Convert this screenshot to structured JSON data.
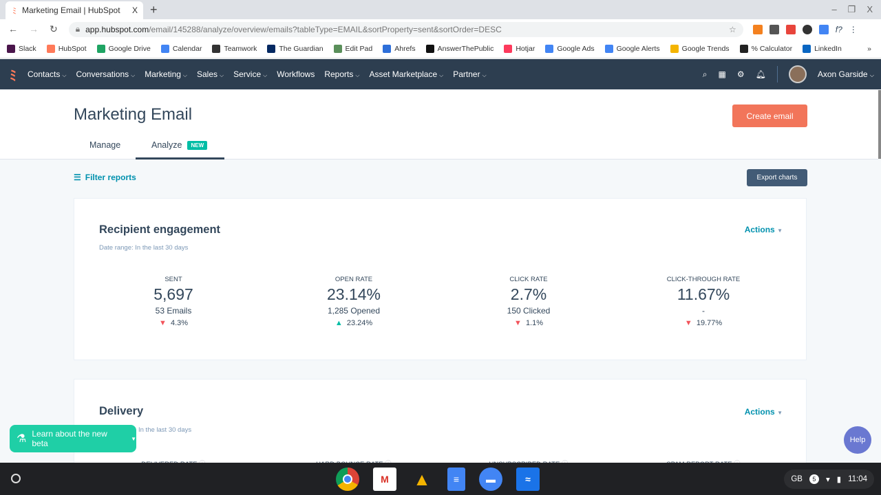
{
  "browser": {
    "tab_title": "Marketing Email | HubSpot",
    "tab_close": "X",
    "new_tab": "+",
    "window_controls": [
      "–",
      "❐",
      "X"
    ],
    "url_host": "app.hubspot.com",
    "url_path": "/email/145288/analyze/overview/emails?tableType=EMAIL&sortProperty=sent&sortOrder=DESC",
    "bookmarks": [
      {
        "label": "Slack",
        "color": "#4a154b"
      },
      {
        "label": "HubSpot",
        "color": "#ff7a59"
      },
      {
        "label": "Google Drive",
        "color": "#1fa463"
      },
      {
        "label": "Calendar",
        "color": "#4285f4"
      },
      {
        "label": "Teamwork",
        "color": "#333333"
      },
      {
        "label": "The Guardian",
        "color": "#052962"
      },
      {
        "label": "Edit Pad",
        "color": "#5a8f5a"
      },
      {
        "label": "Ahrefs",
        "color": "#2e6fd9"
      },
      {
        "label": "AnswerThePublic",
        "color": "#111111"
      },
      {
        "label": "Hotjar",
        "color": "#fd3a5c"
      },
      {
        "label": "Google Ads",
        "color": "#4285f4"
      },
      {
        "label": "Google Alerts",
        "color": "#4285f4"
      },
      {
        "label": "Google Trends",
        "color": "#f4b400"
      },
      {
        "label": "% Calculator",
        "color": "#222222"
      },
      {
        "label": "LinkedIn",
        "color": "#0a66c2"
      }
    ],
    "bookmarks_more": "»"
  },
  "nav": {
    "items": [
      "Contacts",
      "Conversations",
      "Marketing",
      "Sales",
      "Service",
      "Workflows",
      "Reports",
      "Asset Marketplace",
      "Partner"
    ],
    "dropdowns": [
      true,
      true,
      true,
      true,
      true,
      false,
      true,
      true,
      true
    ],
    "user": "Axon Garside"
  },
  "header": {
    "title": "Marketing Email",
    "create_button": "Create email",
    "tabs": [
      "Manage",
      "Analyze"
    ],
    "new_badge": "NEW"
  },
  "toolbar": {
    "filter": "Filter reports",
    "export": "Export charts"
  },
  "engagement": {
    "title": "Recipient engagement",
    "actions": "Actions",
    "date_range": "Date range:  In the last 30 days",
    "stats": [
      {
        "label": "SENT",
        "value": "5,697",
        "sub": "53 Emails",
        "delta": "4.3%",
        "direction": "down"
      },
      {
        "label": "OPEN RATE",
        "value": "23.14%",
        "sub": "1,285 Opened",
        "delta": "23.24%",
        "direction": "up"
      },
      {
        "label": "CLICK RATE",
        "value": "2.7%",
        "sub": "150 Clicked",
        "delta": "1.1%",
        "direction": "down"
      },
      {
        "label": "CLICK-THROUGH RATE",
        "value": "11.67%",
        "sub": "-",
        "delta": "19.77%",
        "direction": "down"
      }
    ]
  },
  "delivery": {
    "title": "Delivery",
    "actions": "Actions",
    "date_range": "In the last 30 days",
    "labels": [
      "DELIVERED RATE",
      "HARD BOUNCE RATE",
      "UNSUBSCRIBED RATE",
      "SPAM REPORT RATE"
    ]
  },
  "beta": "Learn about the new beta",
  "help": "Help",
  "tray": {
    "lang": "GB",
    "badge": "5",
    "time": "11:04"
  },
  "colors": {
    "nav": "#2d3e50",
    "accent": "#f2755a",
    "link": "#0091ae",
    "up": "#00bda5",
    "down": "#f2545b"
  }
}
